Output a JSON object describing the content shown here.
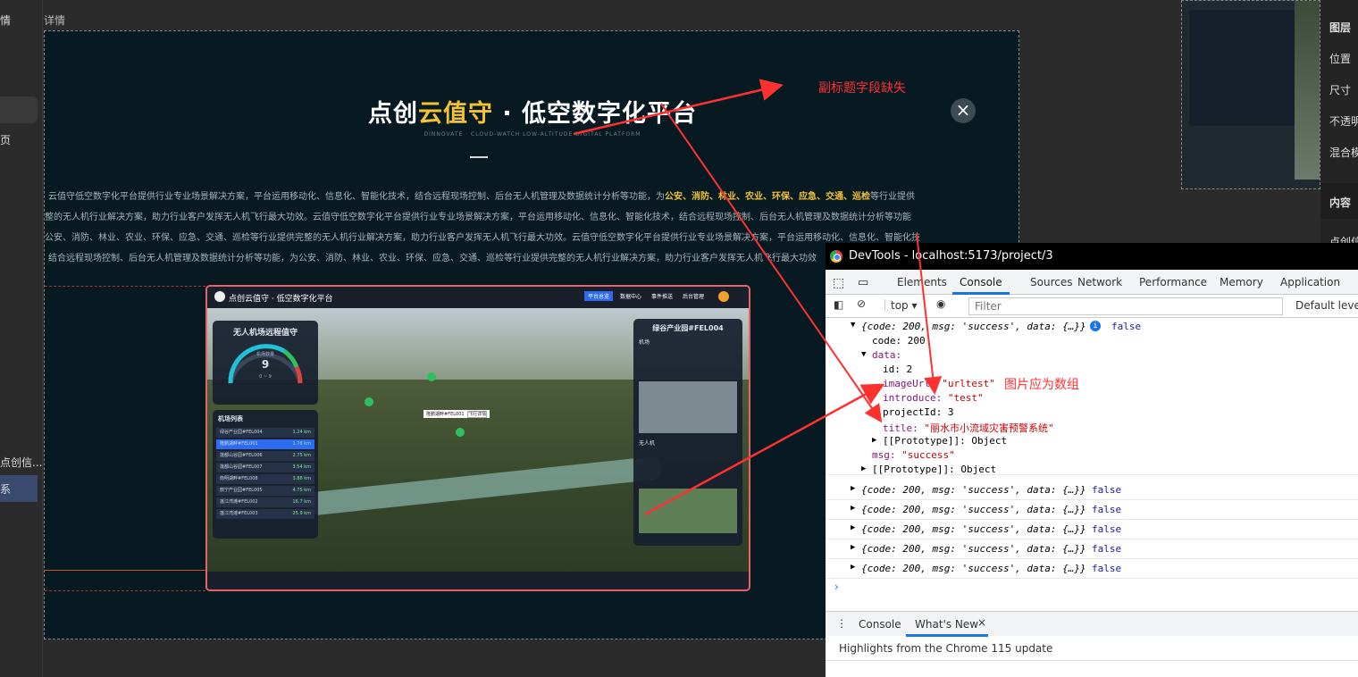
{
  "left_sidebar": {
    "items": [
      "情",
      "页",
      "点创信...",
      "系"
    ]
  },
  "editor": {
    "top_label": "详情"
  },
  "hero": {
    "title_prefix": "点创",
    "title_highlight": "云值守",
    "title_suffix": " · 低空数字化平台",
    "subtitle": "DINNOVATE · CLOUD-WATCH LOW-ALTITUDE DIGITAL PLATFORM",
    "close_icon": "close-icon"
  },
  "paragraph": {
    "line1_pre": "云值守低空数字化平台提供行业专业场景解决方案，平台运用移动化、信息化、智能化技术，结合远程现场控制、后台无人机管理及数据统计分析等功能，为",
    "line1_hl": "公安、消防、林业、农业、环保、应急、交通、巡检",
    "line1_post": "等行业提供",
    "line2": "整的无人机行业解决方案，助力行业客户发挥无人机飞行最大功效。云值守低空数字化平台提供行业专业场景解决方案，平台运用移动化、信息化、智能化技术，结合远程现场控制、后台无人机管理及数据统计分析等功能",
    "line3": "公安、消防、林业、农业、环保、应急、交通、巡检等行业提供完整的无人机行业解决方案，助力行业客户发挥无人机飞行最大功效。云值守低空数字化平台提供行业专业场景解决方案，平台运用移动化、信息化、智能化技",
    "line4": "结合远程现场控制、后台无人机管理及数据统计分析等功能，为公安、消防、林业、农业、环保、应急、交通、巡检等行业提供完整的无人机行业解决方案，助力行业客户发挥无人机飞行最大功效"
  },
  "screenshot": {
    "app_title": "点创云值守 · 低空数字化平台",
    "nav": [
      "平台总览",
      "数据中心",
      "事件推送",
      "后台管理"
    ],
    "gauge_title": "无人机场远程值守",
    "gauge_label": "机场数量",
    "gauge_value": "9",
    "gauge_range": "0 ~ 9",
    "list_title": "机场列表",
    "list_items": [
      "绿谷产业园#FEL004",
      "隆鹏湖畔#FEL001",
      "莲都山谷园#FEL006",
      "莲都山谷园#FEL007",
      "南明湖畔#FEL008",
      "丽宁产业园#FEL005",
      "莲江湾滩#FEL002",
      "莲江湾滩#FEL003"
    ],
    "list_dist": [
      "1.24 km",
      "1.78 km",
      "2.75 km",
      "3.54 km",
      "3.88 km",
      "4.75 km",
      "16.7 km",
      "25.9 km"
    ],
    "right_panel_title": "绿谷产业园#FEL004",
    "right_section1": "机场",
    "right_section2": "无人机",
    "map_popup": "隆鹏湖畔#FEL001",
    "map_popup_btn": "飞行详情"
  },
  "devtools": {
    "window_title": "DevTools - localhost:5173/project/3",
    "tabs": [
      "Elements",
      "Console",
      "Sources",
      "Network",
      "Performance",
      "Memory",
      "Application"
    ],
    "active_tab": "Console",
    "context": "top",
    "filter_placeholder": "Filter",
    "levels": "Default levels",
    "log_summary": "{code: 200, msg: 'success', data: {…}}",
    "false_text": "false",
    "expanded": {
      "code_line": "code: 200",
      "data_line": "data:",
      "id_line": "id: 2",
      "image_key": "imageUrl: ",
      "image_val": "\"urltest\"",
      "intro_key": "introduce: ",
      "intro_val": "\"test\"",
      "project_line": "projectId: 3",
      "title_key": "title: ",
      "title_val": "\"丽水市小流域灾害预警系统\"",
      "proto_line": "[[Prototype]]: Object",
      "msg_key": "msg: ",
      "msg_val": "\"success\""
    },
    "bottom_tabs": [
      "Console",
      "What's New"
    ],
    "news": "Highlights from the Chrome 115 update"
  },
  "right_properties": {
    "items": [
      "图层",
      "位置",
      "尺寸",
      "不透明",
      "混合模",
      "内容",
      "点创信"
    ]
  },
  "annotations": {
    "subtitle_missing": "副标题字段缺失",
    "image_should_be_array": "图片应为数组"
  },
  "colors": {
    "highlight": "#f2c230",
    "annotation": "#ff3030",
    "devtools_accent": "#1a73e8"
  }
}
